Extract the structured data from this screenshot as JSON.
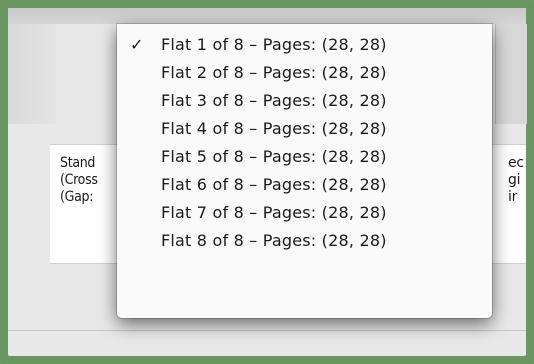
{
  "description": {
    "left_lines": [
      "Stand",
      "(Cross",
      "(Gap:"
    ],
    "right_lines": [
      "ec",
      "gi",
      "ir"
    ]
  },
  "menu": {
    "selected_index": 0,
    "check_glyph": "✓",
    "items": [
      {
        "label": "Flat 1 of 8 – Pages: (28, 28)"
      },
      {
        "label": "Flat 2 of 8 – Pages: (28, 28)"
      },
      {
        "label": "Flat 3 of 8 – Pages: (28, 28)"
      },
      {
        "label": "Flat 4 of 8 – Pages: (28, 28)"
      },
      {
        "label": "Flat 5 of 8 – Pages: (28, 28)"
      },
      {
        "label": "Flat 6 of 8 – Pages: (28, 28)"
      },
      {
        "label": "Flat 7 of 8 – Pages: (28, 28)"
      },
      {
        "label": "Flat 8 of 8 – Pages: (28, 28)"
      }
    ]
  }
}
